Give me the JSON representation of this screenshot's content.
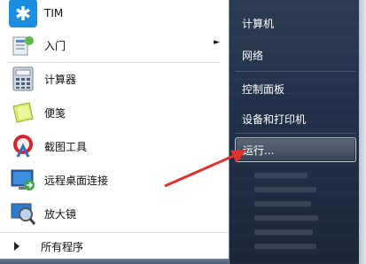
{
  "programs": [
    {
      "label": "TIM",
      "icon": "tim-icon",
      "has_submenu": false
    },
    {
      "label": "入门",
      "icon": "getting-started-icon",
      "has_submenu": true
    },
    {
      "label": "计算器",
      "icon": "calculator-icon",
      "has_submenu": false
    },
    {
      "label": "便笺",
      "icon": "sticky-notes-icon",
      "has_submenu": false
    },
    {
      "label": "截图工具",
      "icon": "snipping-tool-icon",
      "has_submenu": false
    },
    {
      "label": "远程桌面连接",
      "icon": "remote-desktop-icon",
      "has_submenu": false
    },
    {
      "label": "放大镜",
      "icon": "magnifier-icon",
      "has_submenu": false
    }
  ],
  "submenu_arrow": "►",
  "all_programs": "所有程序",
  "right_menu": [
    {
      "label": "计算机"
    },
    {
      "label": "网络"
    },
    {
      "label": "控制面板"
    },
    {
      "label": "设备和打印机"
    },
    {
      "label": "运行..."
    }
  ],
  "colors": {
    "annotation_arrow": "#e0322f",
    "tim_icon_bg": "#1a8ee1"
  }
}
